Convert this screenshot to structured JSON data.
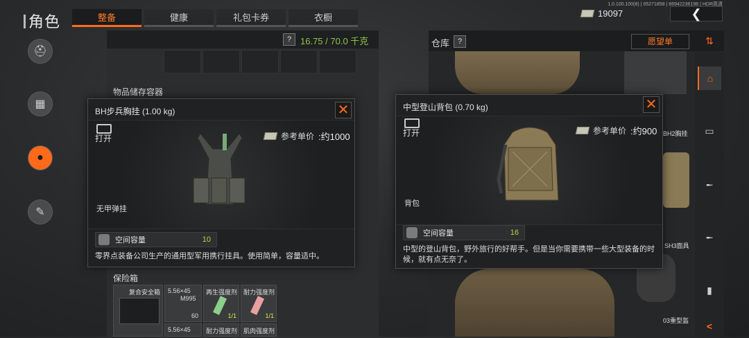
{
  "header": {
    "title": "角色",
    "version": "1.0.100.100(8) | 05271858 | 86942236198 | HDR高清",
    "currency_value": "19097",
    "back_glyph": "❮"
  },
  "tabs": [
    {
      "label": "整备",
      "active": true
    },
    {
      "label": "健康",
      "active": false
    },
    {
      "label": "礼包卡券",
      "active": false
    },
    {
      "label": "衣橱",
      "active": false
    }
  ],
  "sidebar": {
    "items": [
      {
        "icon": "helmet-icon",
        "glyph": "⛑"
      },
      {
        "icon": "vest-icon",
        "glyph": "▦"
      },
      {
        "icon": "backpack-icon",
        "glyph": "●"
      },
      {
        "icon": "tools-icon",
        "glyph": "✎"
      }
    ]
  },
  "center": {
    "weight": "16.75 / 70.0 千克",
    "help_glyph": "?",
    "storage_title": "物品储存容器",
    "safe_title": "保险箱",
    "safe_items": [
      {
        "name": "复合安全箱"
      },
      {
        "name": "5.56×45",
        "sub": "M995",
        "count": "60"
      },
      {
        "name": "再生强度剂",
        "count": "1/1"
      },
      {
        "name": "耐力强度剂",
        "count": "1/1"
      },
      {
        "name": "5.56×45"
      },
      {
        "name": "耐力强度剂"
      },
      {
        "name": "肌肉强度剂"
      }
    ]
  },
  "warehouse": {
    "title": "仓库",
    "help_glyph": "?",
    "wishlist_label": "愿望单",
    "labels": [
      "BH2胸挂",
      "SH3面具",
      "03重型盔"
    ],
    "rail": [
      {
        "icon": "sort-icon",
        "glyph": "⇅"
      },
      {
        "icon": "home-icon",
        "glyph": "⌂",
        "active": true
      },
      {
        "icon": "container-icon",
        "glyph": "▭"
      },
      {
        "icon": "rifle-icon",
        "glyph": "╾"
      },
      {
        "icon": "rifle2-icon",
        "glyph": "╾"
      },
      {
        "icon": "ammo-icon",
        "glyph": "▮"
      },
      {
        "icon": "collapse-icon",
        "glyph": "<"
      }
    ]
  },
  "popup_left": {
    "title": "BH步兵胸挂 (1.00 kg)",
    "open_label": "打开",
    "price_label": "参考单价",
    "price_value": ":约1000",
    "category": "无甲弹挂",
    "capacity_label": "空间容量",
    "capacity_value": "10",
    "description": "零界点装备公司生产的通用型军用携行挂具。使用简单，容量适中。"
  },
  "popup_right": {
    "title": "中型登山背包 (0.70 kg)",
    "open_label": "打开",
    "price_label": "参考单价",
    "price_value": ":约900",
    "category": "背包",
    "capacity_label": "空间容量",
    "capacity_value": "16",
    "description": "中型的登山背包，野外旅行的好帮手。但是当你需要携带一些大型装备的时候，就有点无奈了。"
  },
  "colors": {
    "accent": "#ff6a1a",
    "weight_green": "#8fc34a",
    "capacity_green": "#b6d84a"
  }
}
